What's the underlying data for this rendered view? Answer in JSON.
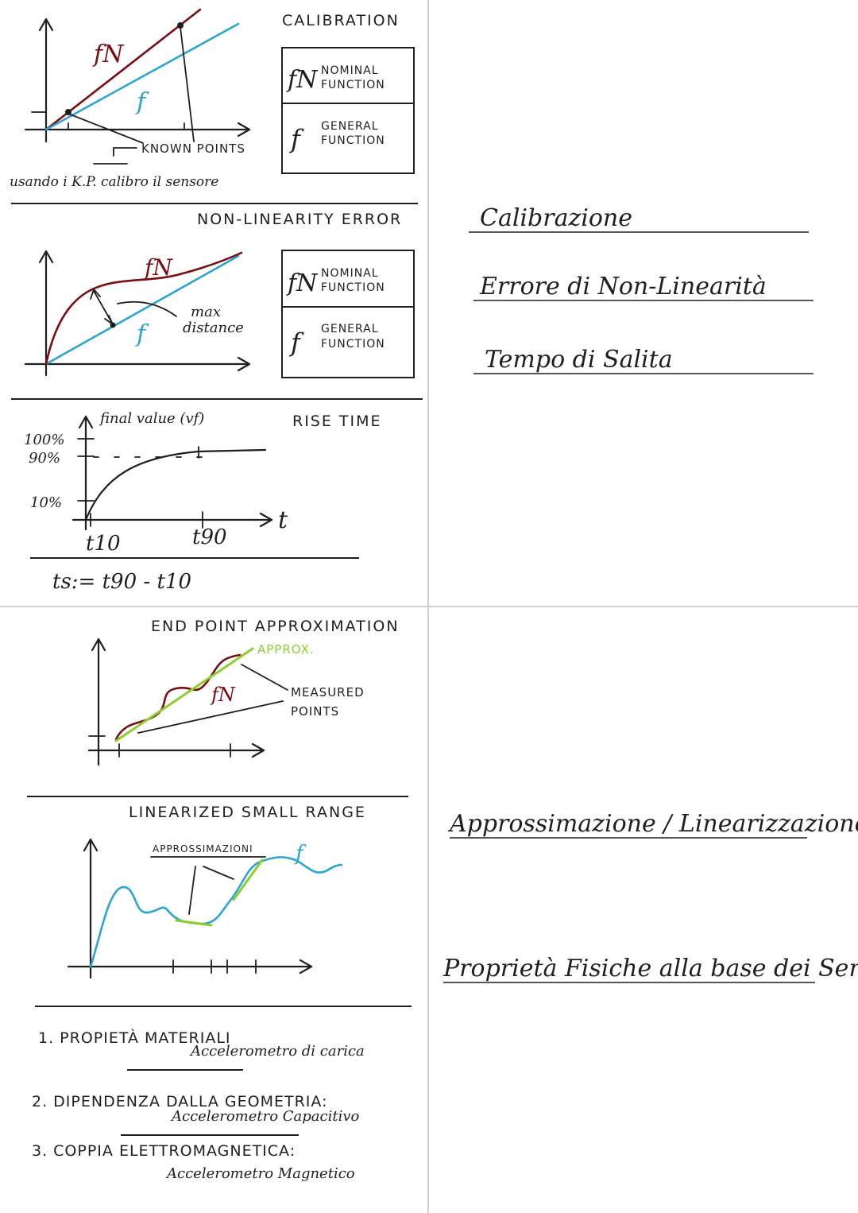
{
  "calibration": {
    "heading": "CALIBRATION",
    "label_fn": "fN",
    "label_f": "f",
    "legend_nominal_symbol": "fN",
    "legend_nominal_text_1": "NOMINAL",
    "legend_nominal_text_2": "FUNCTION",
    "legend_general_symbol": "f",
    "legend_general_text_1": "GENERAL",
    "legend_general_text_2": "FUNCTION",
    "known_points": "KNOWN POINTS",
    "note": "usando i K.P. calibro il sensore"
  },
  "nonlinearity": {
    "heading": "NON-LINEARITY ERROR",
    "label_fn": "fN",
    "label_f": "f",
    "max_distance_1": "max",
    "max_distance_2": "distance",
    "legend_nominal_symbol": "fN",
    "legend_nominal_text_1": "NOMINAL",
    "legend_nominal_text_2": "FUNCTION",
    "legend_general_symbol": "f",
    "legend_general_text_1": "GENERAL",
    "legend_general_text_2": "FUNCTION"
  },
  "rise_time": {
    "heading": "RISE TIME",
    "final_value": "final value (vf)",
    "y_labels": [
      "100%",
      "90%",
      "10%"
    ],
    "x_t10": "t10",
    "x_t90": "t90",
    "x_axis": "t",
    "formula": "ts:= t90 - t10"
  },
  "end_point": {
    "heading": "END POINT APPROXIMATION",
    "approx": "APPROX.",
    "label_fn": "fN",
    "measured_1": "MEASURED",
    "measured_2": "POINTS"
  },
  "linearized": {
    "heading": "LINEARIZED SMALL RANGE",
    "approx_label": "APPROSSIMAZIONI",
    "label_f": "f"
  },
  "properties": {
    "item1_title": "1. PROPIETÀ MATERIALI",
    "item1_sub": "Accelerometro di carica",
    "item2_title": "2. DIPENDENZA DALLA GEOMETRIA:",
    "item2_sub": "Accelerometro Capacitivo",
    "item3_title": "3. COPPIA ELETTROMAGNETICA:",
    "item3_sub": "Accelerometro Magnetico"
  },
  "right_titles": {
    "t1": "Calibrazione",
    "t2": "Errore di Non-Linearità",
    "t3": "Tempo di Salita",
    "t4": "Approssimazione / Linearizzazione",
    "t5": "Proprietà Fisiche alla base dei Sensori"
  },
  "colors": {
    "nominal": "#7a0d12",
    "general": "#2ba4d3",
    "approx": "#8ccf2d",
    "ink": "#1f1f1f"
  }
}
